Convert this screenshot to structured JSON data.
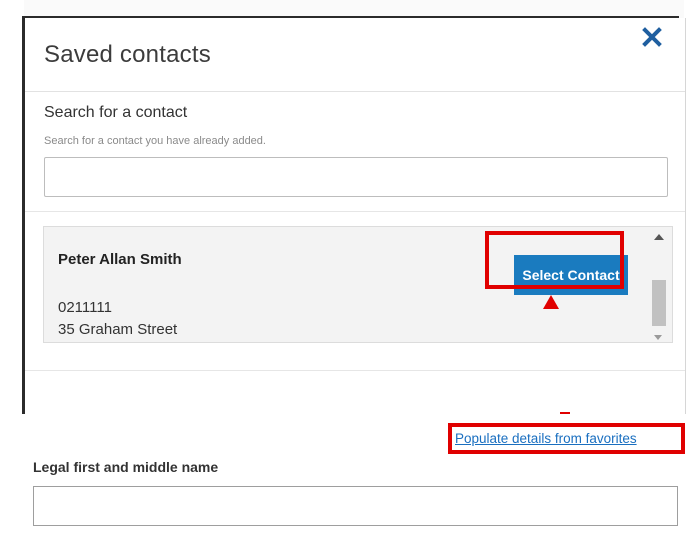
{
  "modal": {
    "title": "Saved contacts",
    "close_icon": "close-x-icon",
    "search": {
      "label": "Search for a contact",
      "hint": "Search for a contact you have already added.",
      "value": "",
      "placeholder": ""
    },
    "contact": {
      "name": "Peter Allan Smith",
      "phone": "0211111",
      "address": "35 Graham Street",
      "select_label": "Select Contact"
    }
  },
  "form": {
    "populate_link": "Populate details from favorites",
    "legal_name_label": "Legal first and middle name",
    "legal_name_value": ""
  },
  "colors": {
    "accent": "#1a7bbf",
    "link": "#1a6fc0",
    "highlight": "#e00000"
  }
}
